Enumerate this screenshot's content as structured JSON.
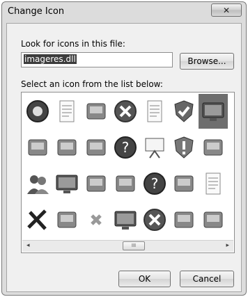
{
  "window": {
    "title": "Change Icon",
    "close_glyph": "✕"
  },
  "form": {
    "look_label": "Look for icons in this file:",
    "file_value": "imageres.dll",
    "browse_label": "Browse...",
    "select_label": "Select an icon from the list below:"
  },
  "scrollbar": {
    "left_glyph": "◂",
    "right_glyph": "▸",
    "thumb_grip": "III"
  },
  "buttons": {
    "ok": "OK",
    "cancel": "Cancel"
  },
  "icon_rows": [
    [
      "media-center-icon",
      "document-icon",
      "projector-connection-icon",
      "error-x-icon",
      "blank-page-icon",
      "shield-check-icon",
      "monitor-screen-icon",
      "partial-gear-icon"
    ],
    [
      "control-panel-icon",
      "scanner-printer-icon",
      "scanner-icon",
      "help-question-icon",
      "presentation-easel-icon",
      "shield-warning-icon",
      "network-services-icon",
      "partial-computer-icon"
    ],
    [
      "users-group-icon",
      "display-icon",
      "film-frame-icon",
      "picture-frame-icon",
      "shield-question-icon",
      "media-music-icon",
      "documents-icon",
      "partial-list-icon"
    ],
    [
      "check-x-mark-icon",
      "pda-device-icon",
      "small-x-icon",
      "monitor-eclipse-icon",
      "shield-x-icon",
      "computer-network-icon",
      "computer-docs-icon",
      "partial-clock-icon"
    ]
  ],
  "selected_icon": "monitor-screen-icon"
}
